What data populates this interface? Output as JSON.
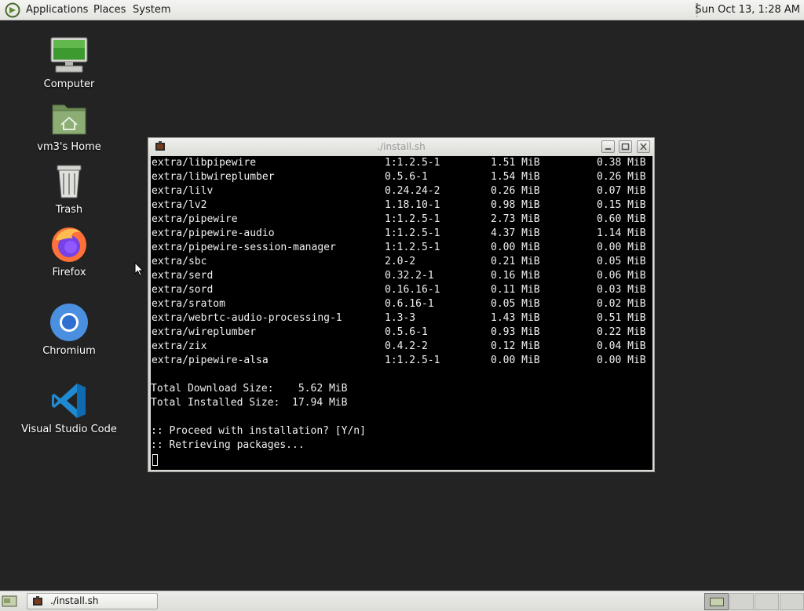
{
  "top_panel": {
    "menus": [
      "Applications",
      "Places",
      "System"
    ],
    "clock": "Sun Oct 13,  1:28 AM"
  },
  "desktop": {
    "icons": [
      {
        "label": "Computer",
        "icon": "computer-icon"
      },
      {
        "label": "vm3's Home",
        "icon": "home-folder-icon"
      },
      {
        "label": "Trash",
        "icon": "trash-icon"
      },
      {
        "label": "Firefox",
        "icon": "firefox-icon"
      },
      {
        "label": "Chromium",
        "icon": "chromium-icon"
      },
      {
        "label": "Visual Studio Code",
        "icon": "vscode-icon"
      }
    ]
  },
  "terminal": {
    "title": "./install.sh",
    "packages": [
      [
        "extra/libpipewire",
        "1:1.2.5-1",
        "1.51 MiB",
        "0.38 MiB"
      ],
      [
        "extra/libwireplumber",
        "0.5.6-1",
        "1.54 MiB",
        "0.26 MiB"
      ],
      [
        "extra/lilv",
        "0.24.24-2",
        "0.26 MiB",
        "0.07 MiB"
      ],
      [
        "extra/lv2",
        "1.18.10-1",
        "0.98 MiB",
        "0.15 MiB"
      ],
      [
        "extra/pipewire",
        "1:1.2.5-1",
        "2.73 MiB",
        "0.60 MiB"
      ],
      [
        "extra/pipewire-audio",
        "1:1.2.5-1",
        "4.37 MiB",
        "1.14 MiB"
      ],
      [
        "extra/pipewire-session-manager",
        "1:1.2.5-1",
        "0.00 MiB",
        "0.00 MiB"
      ],
      [
        "extra/sbc",
        "2.0-2",
        "0.21 MiB",
        "0.05 MiB"
      ],
      [
        "extra/serd",
        "0.32.2-1",
        "0.16 MiB",
        "0.06 MiB"
      ],
      [
        "extra/sord",
        "0.16.16-1",
        "0.11 MiB",
        "0.03 MiB"
      ],
      [
        "extra/sratom",
        "0.6.16-1",
        "0.05 MiB",
        "0.02 MiB"
      ],
      [
        "extra/webrtc-audio-processing-1",
        "1.3-3",
        "1.43 MiB",
        "0.51 MiB"
      ],
      [
        "extra/wireplumber",
        "0.5.6-1",
        "0.93 MiB",
        "0.22 MiB"
      ],
      [
        "extra/zix",
        "0.4.2-2",
        "0.12 MiB",
        "0.04 MiB"
      ],
      [
        "extra/pipewire-alsa",
        "1:1.2.5-1",
        "0.00 MiB",
        "0.00 MiB"
      ]
    ],
    "download_size_line": "Total Download Size:    5.62 MiB",
    "installed_size_line": "Total Installed Size:  17.94 MiB",
    "proceed_line": ":: Proceed with installation? [Y/n]",
    "retrieving_line": ":: Retrieving packages..."
  },
  "taskbar": {
    "task_label": "./install.sh",
    "workspaces": 4,
    "active_workspace": 1
  }
}
